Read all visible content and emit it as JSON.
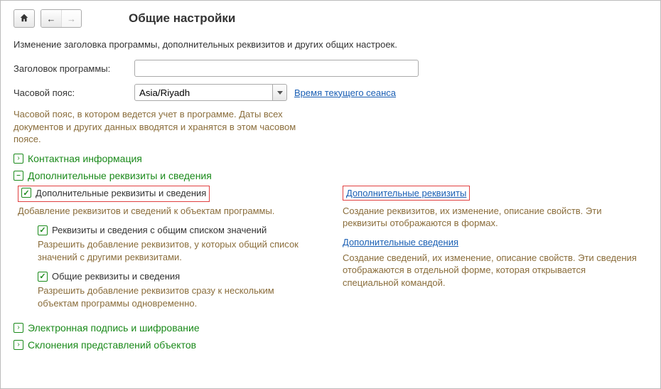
{
  "toolbar": {
    "page_title": "Общие настройки"
  },
  "subtitle": "Изменение заголовка программы, дополнительных реквизитов и других общих настроек.",
  "form": {
    "program_title_label": "Заголовок программы:",
    "program_title_value": "",
    "timezone_label": "Часовой пояс:",
    "timezone_value": "Asia/Riyadh",
    "session_time_link": "Время текущего сеанса",
    "timezone_hint": "Часовой пояс, в котором ведется учет в программе. Даты всех документов и других данных вводятся и хранятся в этом часовом поясе."
  },
  "sections": {
    "contact": {
      "title": "Контактная информация",
      "icon": "›"
    },
    "extra": {
      "title": "Дополнительные реквизиты и сведения",
      "icon": "–",
      "left": {
        "main_cb": "Дополнительные реквизиты и сведения",
        "main_hint": "Добавление реквизитов и сведений к объектам программы.",
        "sub1_cb": "Реквизиты и сведения с общим списком значений",
        "sub1_hint": "Разрешить добавление реквизитов, у которых общий список значений с другими реквизитами.",
        "sub2_cb": "Общие реквизиты и сведения",
        "sub2_hint": "Разрешить добавление реквизитов сразу к нескольким объектам программы одновременно."
      },
      "right": {
        "link1": "Дополнительные реквизиты",
        "hint1": "Создание реквизитов, их изменение, описание свойств. Эти реквизиты отображаются в формах.",
        "link2": "Дополнительные сведения",
        "hint2": "Создание сведений, их изменение, описание свойств. Эти сведения отображаются в отдельной форме, которая открывается специальной командой."
      }
    },
    "signature": {
      "title": "Электронная подпись и шифрование",
      "icon": "›"
    },
    "declensions": {
      "title": "Склонения представлений объектов",
      "icon": "›"
    }
  }
}
